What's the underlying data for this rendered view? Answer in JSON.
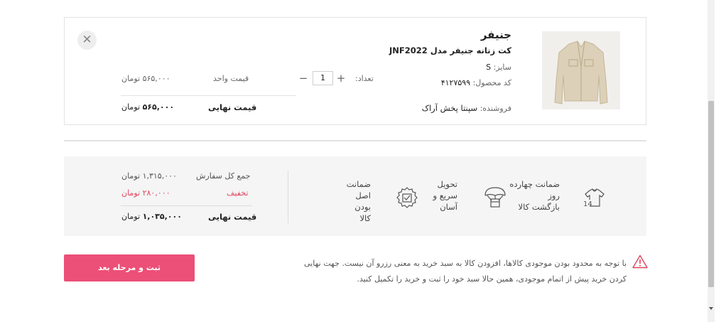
{
  "product": {
    "name": "جنیفر",
    "subtitle": "کت زنانه جنیفر مدل JNF2022",
    "size_label": "سایز:",
    "size_value": "S",
    "code_label": "کد محصول:",
    "code_value": "۴۱۲۷۵۹۹",
    "seller_label": "فروشنده:",
    "seller_value": "سپنتا پخش آراک",
    "quantity_label": "تعداد:",
    "quantity_value": "1",
    "unit_price_label": "قیمت واحد",
    "unit_price": "۵۶۵,۰۰۰ تومان",
    "final_price_label": "قیمت نهایی",
    "final_price_amount": "۵۶۵,۰۰۰",
    "currency": "تومان",
    "remove_icon": "close-icon"
  },
  "summary": {
    "total_label": "جمع کل سفارش",
    "total_value": "۱,۳۱۵,۰۰۰ تومان",
    "discount_label": "تخفیف",
    "discount_value": "۲۸۰,۰۰۰ تومان",
    "final_label": "قیمت نهایی",
    "final_amount": "۱,۰۳۵,۰۰۰",
    "currency": "تومان"
  },
  "features": [
    {
      "icon": "return-14-days-icon",
      "line1": "ضمانت چهارده",
      "line2": "روز",
      "line3": "بازگشت کالا"
    },
    {
      "icon": "fast-delivery-icon",
      "line1": "تحویل",
      "line2": "سریع و",
      "line3": "آسان"
    },
    {
      "icon": "original-guarantee-icon",
      "line1": "ضمانت",
      "line2": "اصل بودن",
      "line3": "کالا"
    }
  ],
  "notice": {
    "icon": "warning-icon",
    "text": "با توجه به محدود بودن موجودی کالاها، افزودن کالا به سبد خرید به معنی رزرو آن نیست. جهت نهایی کردن خرید پیش از اتمام موجودی، همین حالا سبد خود را ثبت و خرید را تکمیل کنید."
  },
  "actions": {
    "submit_label": "ثبت و مرحله بعد"
  },
  "colors": {
    "accent": "#ec4f77",
    "discount": "#e0455e"
  }
}
